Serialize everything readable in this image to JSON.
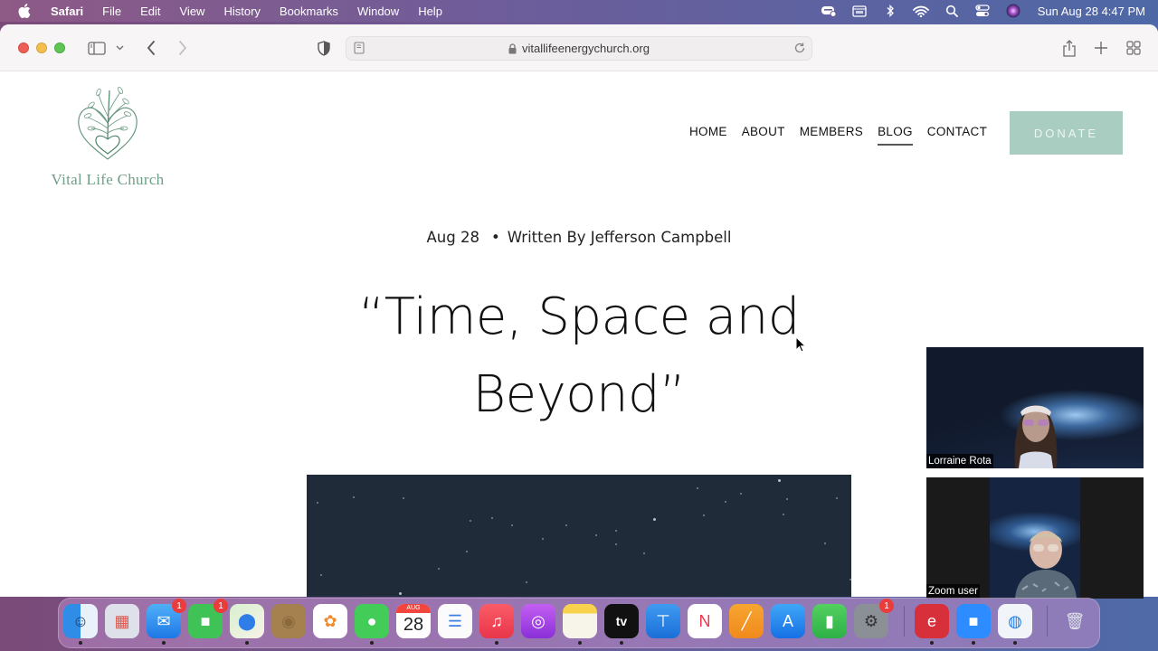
{
  "menubar": {
    "app_name": "Safari",
    "items": [
      "File",
      "Edit",
      "View",
      "History",
      "Bookmarks",
      "Window",
      "Help"
    ],
    "status_icons": [
      "expressvpn-icon",
      "screen-share-icon",
      "bluetooth-icon",
      "wifi-icon",
      "spotlight-search-icon",
      "control-center-icon",
      "siri-icon"
    ],
    "clock": "Sun Aug 28  4:47 PM"
  },
  "browser": {
    "url": "vitallifeenergychurch.org"
  },
  "site": {
    "logo_text": "Vital Life Church",
    "nav": [
      {
        "label": "HOME",
        "active": false
      },
      {
        "label": "ABOUT",
        "active": false
      },
      {
        "label": "MEMBERS",
        "active": false
      },
      {
        "label": "BLOG",
        "active": true
      },
      {
        "label": "CONTACT",
        "active": false
      }
    ],
    "donate_label": "DONATE",
    "accent_color": "#a9cdc1",
    "logo_color": "#6f9e86"
  },
  "post": {
    "date": "Aug 28",
    "separator": "•",
    "byline": "Written By Jefferson Campbell",
    "title_line1": "“Time, Space and",
    "title_line2": "Beyond”"
  },
  "zoom": {
    "participants": [
      {
        "name": "Lorraine Rota"
      },
      {
        "name": "Zoom user"
      }
    ]
  },
  "dock": {
    "apps": [
      {
        "name": "Finder",
        "running": true,
        "badge": null
      },
      {
        "name": "Launchpad",
        "running": false,
        "badge": null
      },
      {
        "name": "Mail",
        "running": true,
        "badge": "1"
      },
      {
        "name": "FaceTime",
        "running": false,
        "badge": "1"
      },
      {
        "name": "Maps",
        "running": true,
        "badge": null
      },
      {
        "name": "Contacts",
        "running": false,
        "badge": null
      },
      {
        "name": "Photos",
        "running": false,
        "badge": null
      },
      {
        "name": "Messages",
        "running": true,
        "badge": null
      },
      {
        "name": "Calendar",
        "running": false,
        "badge": null,
        "month": "AUG",
        "day": "28"
      },
      {
        "name": "Reminders",
        "running": false,
        "badge": null
      },
      {
        "name": "Music",
        "running": true,
        "badge": null
      },
      {
        "name": "Podcasts",
        "running": false,
        "badge": null
      },
      {
        "name": "Notes",
        "running": true,
        "badge": null
      },
      {
        "name": "TV",
        "running": true,
        "badge": null,
        "label": "tv"
      },
      {
        "name": "Keynote",
        "running": false,
        "badge": null
      },
      {
        "name": "News",
        "running": false,
        "badge": null
      },
      {
        "name": "Pages",
        "running": false,
        "badge": null
      },
      {
        "name": "App Store",
        "running": false,
        "badge": null
      },
      {
        "name": "Numbers",
        "running": false,
        "badge": null
      },
      {
        "name": "System Preferences",
        "running": false,
        "badge": "1"
      },
      {
        "name": "ExpressVPN",
        "running": true,
        "badge": null
      },
      {
        "name": "Zoom",
        "running": true,
        "badge": null
      },
      {
        "name": "Safari",
        "running": true,
        "badge": null
      },
      {
        "name": "Trash",
        "running": false,
        "badge": null
      }
    ]
  }
}
